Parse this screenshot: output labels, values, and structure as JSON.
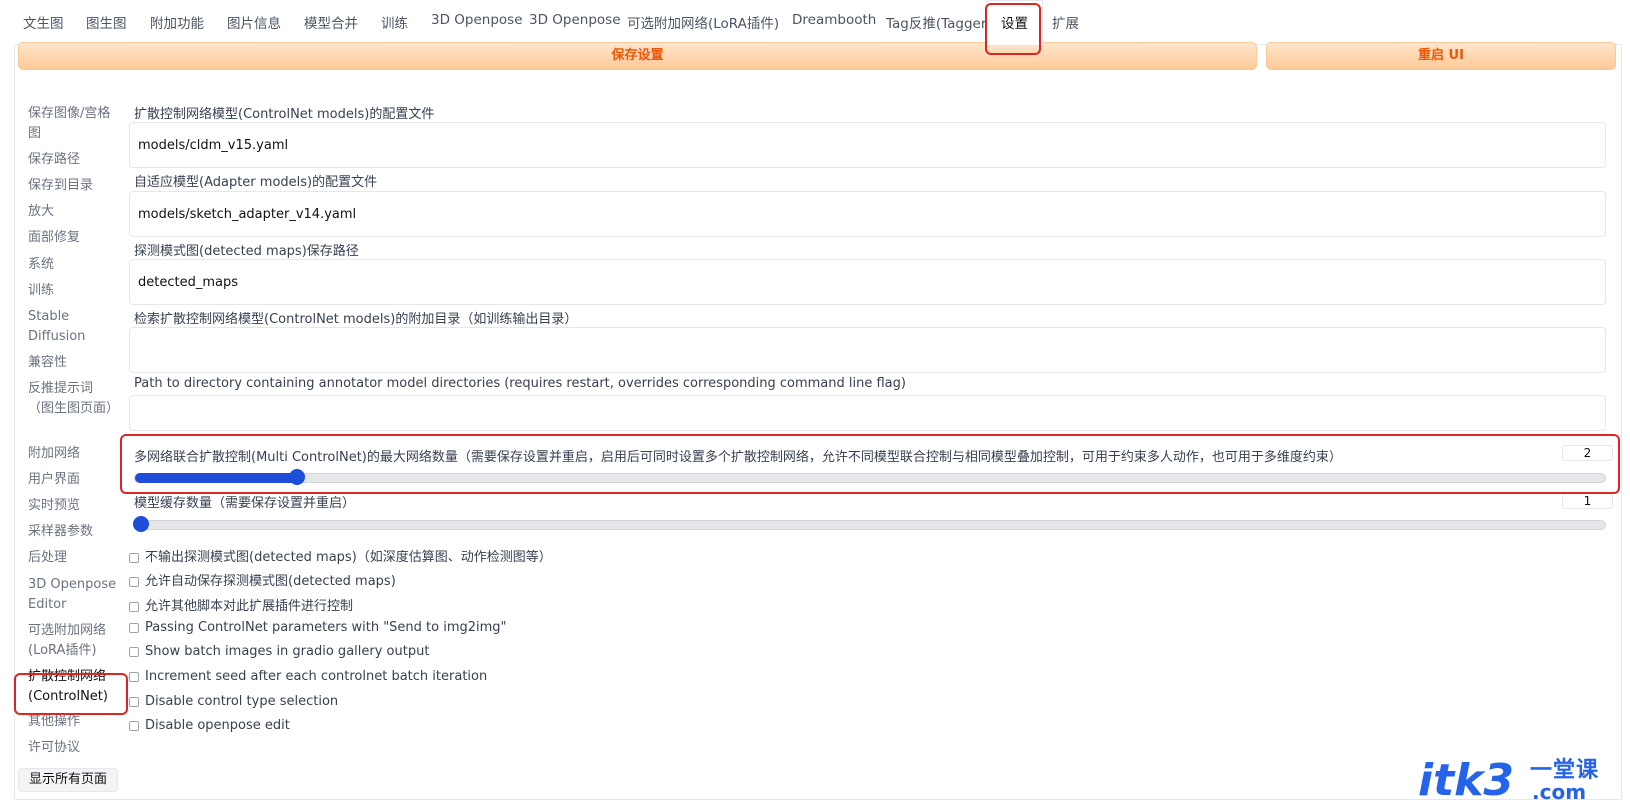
{
  "tabs": [
    {
      "label": "文生图"
    },
    {
      "label": "图生图"
    },
    {
      "label": "附加功能"
    },
    {
      "label": "图片信息"
    },
    {
      "label": "模型合并"
    },
    {
      "label": "训练"
    },
    {
      "label": "3D Openpose"
    },
    {
      "label": "3D Openpose"
    },
    {
      "label": "可选附加网络(LoRA插件)"
    },
    {
      "label": "Dreambooth"
    },
    {
      "label": "Tag反推(Tagger)"
    },
    {
      "label": "设置"
    },
    {
      "label": "扩展"
    }
  ],
  "active_tab": "设置",
  "toolbar": {
    "save_label": "保存设置",
    "restart_label": "重启 UI"
  },
  "sidebar": {
    "items": [
      {
        "label": "保存图像/宫格图"
      },
      {
        "label": "保存路径"
      },
      {
        "label": "保存到目录"
      },
      {
        "label": "放大"
      },
      {
        "label": "面部修复"
      },
      {
        "label": "系统"
      },
      {
        "label": "训练"
      },
      {
        "label": "Stable Diffusion"
      },
      {
        "label": "兼容性"
      },
      {
        "label": "反推提示词（图生图页面）"
      },
      {
        "label": "附加网络"
      },
      {
        "label": "用户界面"
      },
      {
        "label": "实时预览"
      },
      {
        "label": "采样器参数"
      },
      {
        "label": "后处理"
      },
      {
        "label": "3D Openpose Editor"
      },
      {
        "label": "可选附加网络(LoRA插件)"
      },
      {
        "label": "扩散控制网络(ControlNet)"
      },
      {
        "label": "其他操作"
      },
      {
        "label": "许可协议"
      }
    ],
    "show_all_label": "显示所有页面"
  },
  "fields": [
    {
      "label": "扩散控制网络模型(ControlNet models)的配置文件",
      "value": "models/cldm_v15.yaml"
    },
    {
      "label": "自适应模型(Adapter models)的配置文件",
      "value": "models/sketch_adapter_v14.yaml"
    },
    {
      "label": "探测模式图(detected maps)保存路径",
      "value": "detected_maps"
    },
    {
      "label": "检索扩散控制网络模型(ControlNet models)的附加目录（如训练输出目录）",
      "value": ""
    },
    {
      "label": "Path to directory containing annotator model directories (requires restart, overrides corresponding command line flag)",
      "value": ""
    }
  ],
  "sliders": [
    {
      "label": "多网络联合扩散控制(Multi ControlNet)的最大网络数量（需要保存设置并重启，启用后可同时设置多个扩散控制网络，允许不同模型联合控制与相同模型叠加控制，可用于约束多人动作，也可用于多维度约束）",
      "value": "2",
      "fraction": 0.11
    },
    {
      "label": "模型缓存数量（需要保存设置并重启）",
      "value": "1",
      "fraction": 0.0
    }
  ],
  "checkboxes": [
    {
      "label": "不输出探测模式图(detected maps)（如深度估算图、动作检测图等）"
    },
    {
      "label": "允许自动保存探测模式图(detected maps)"
    },
    {
      "label": "允许其他脚本对此扩展插件进行控制"
    },
    {
      "label": "Passing ControlNet parameters with \"Send to img2img\""
    },
    {
      "label": "Show batch images in gradio gallery output"
    },
    {
      "label": "Increment seed after each controlnet batch iteration"
    },
    {
      "label": "Disable control type selection"
    },
    {
      "label": "Disable openpose edit"
    }
  ],
  "watermark": {
    "brand": "itk3",
    "cn": "一堂课",
    "domain": ".com"
  },
  "colors": {
    "accent": "#1d4ed8",
    "orange": "#ea580c",
    "highlight": "#dc2626"
  }
}
